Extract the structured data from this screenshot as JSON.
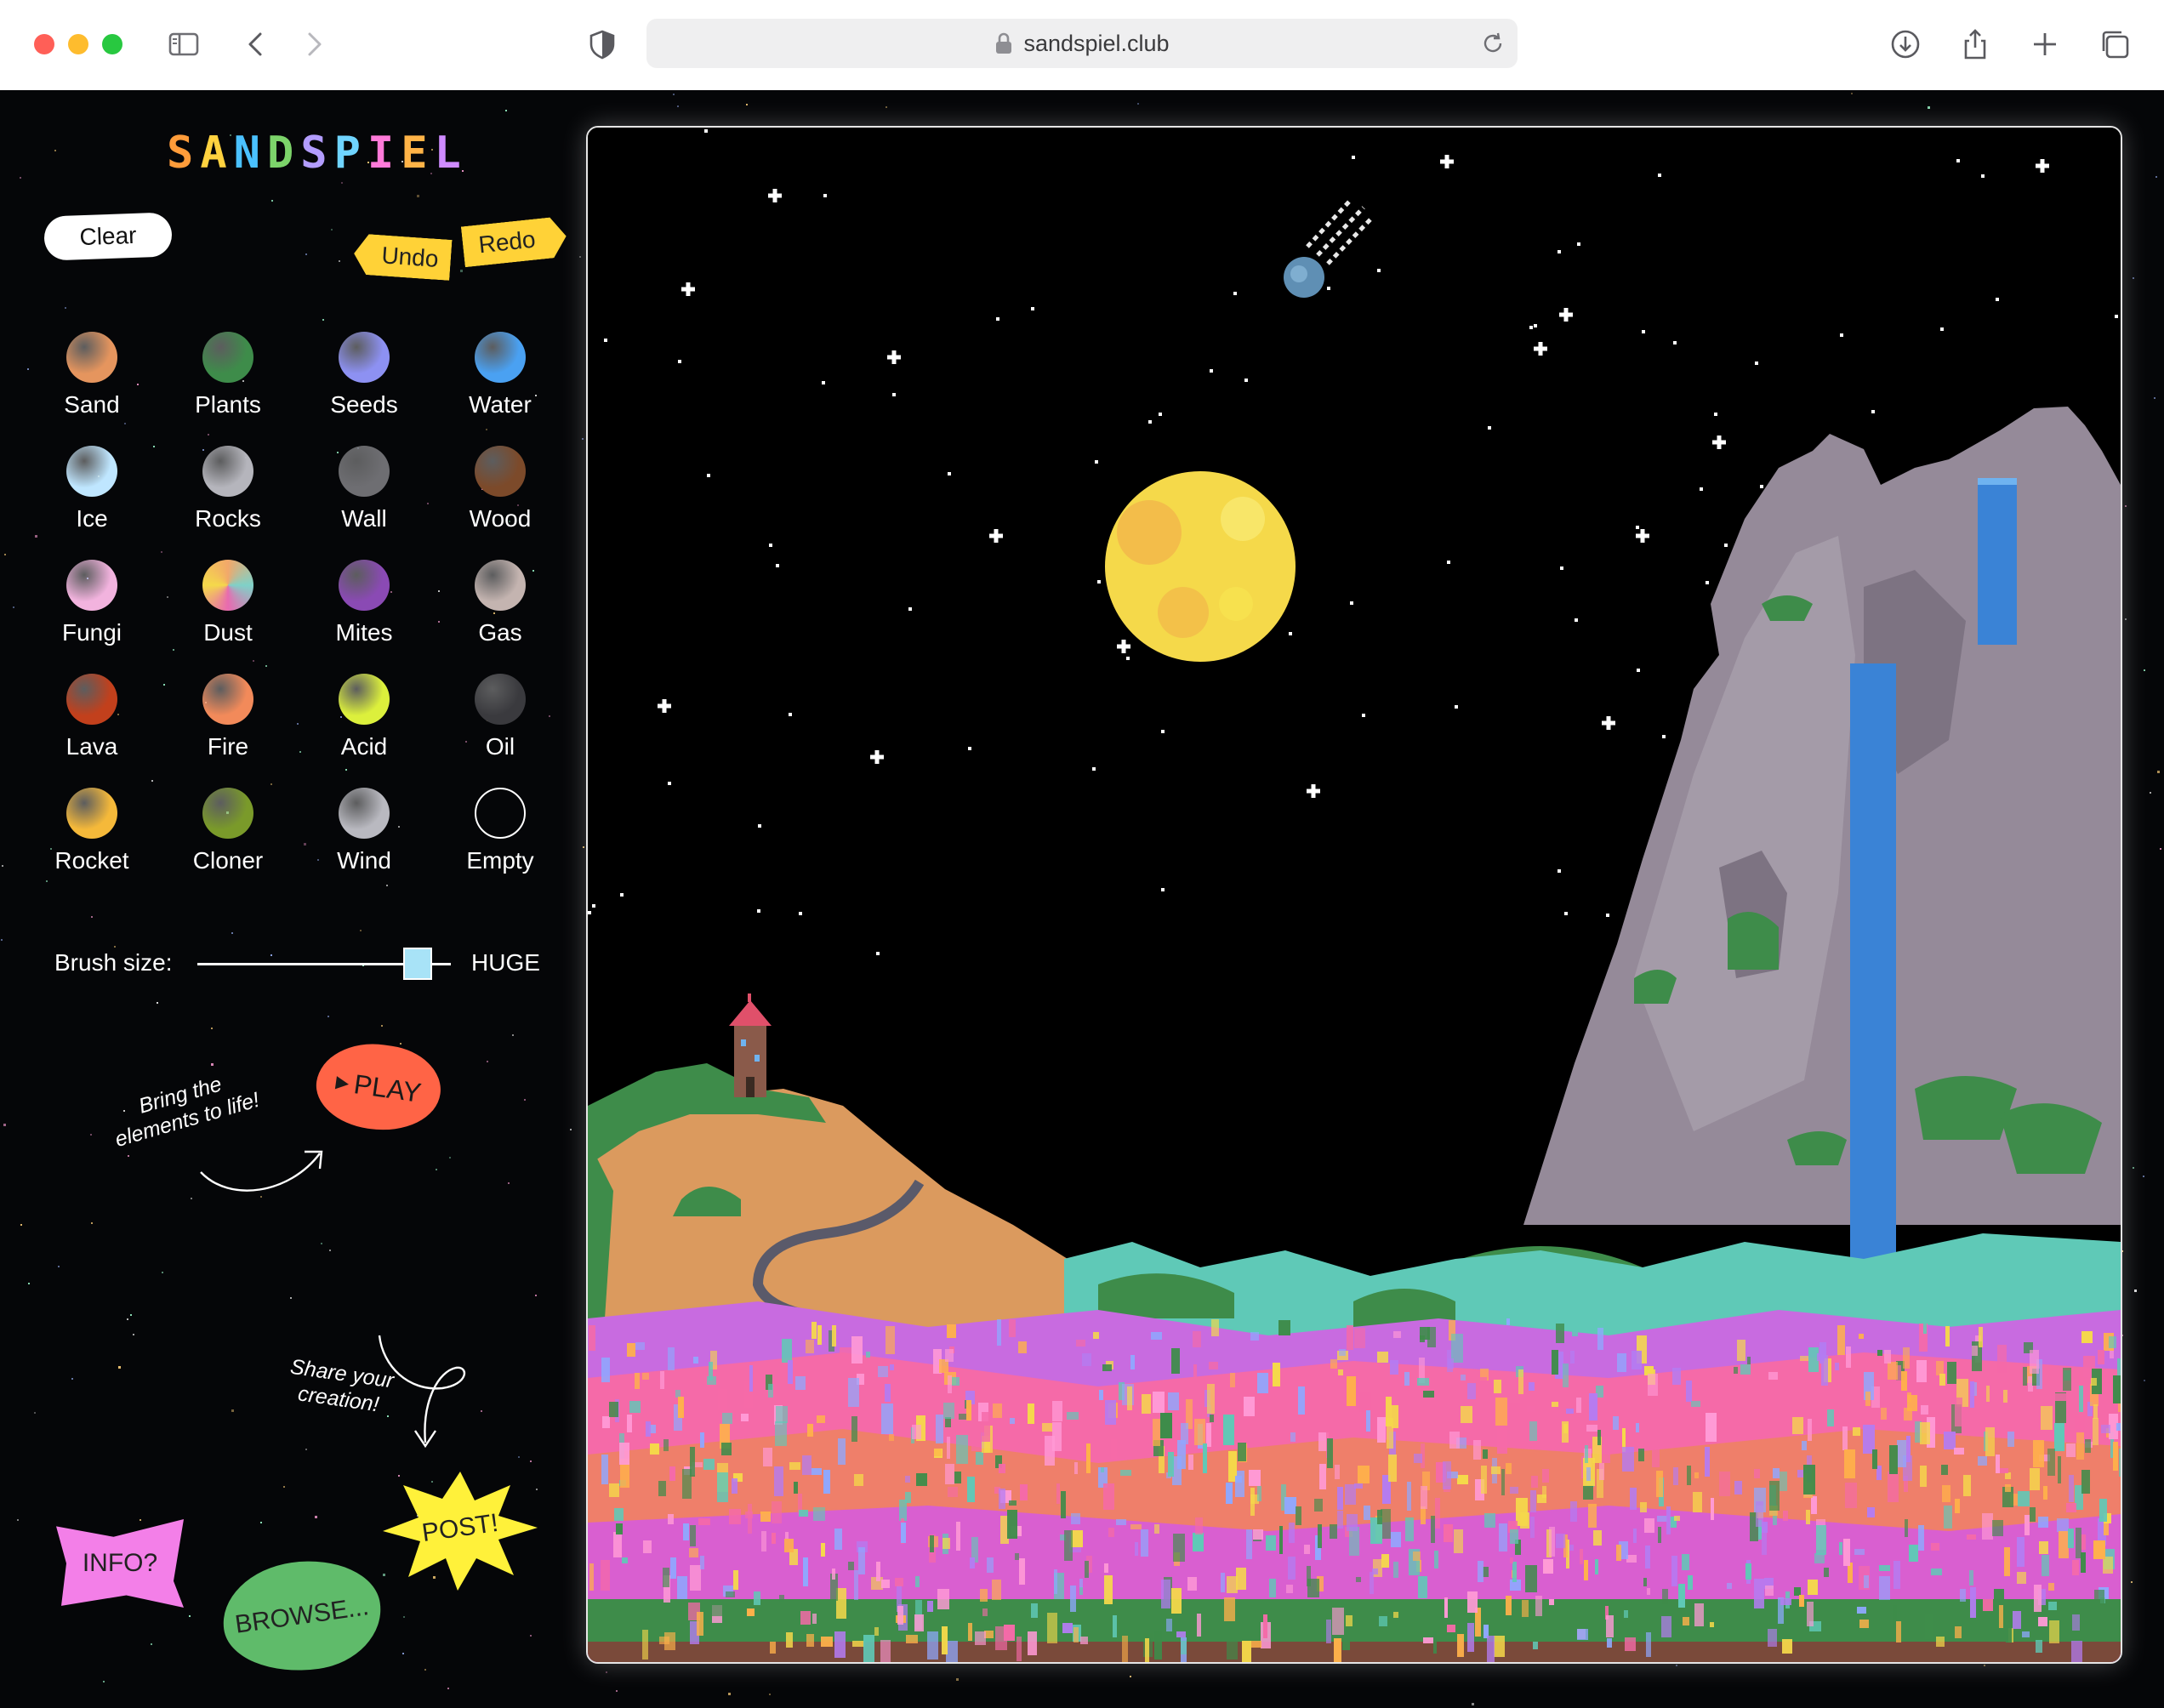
{
  "browser": {
    "url": "sandspiel.club",
    "traffic_lights": [
      "#ff5f57",
      "#febc2e",
      "#28c840"
    ],
    "icons": [
      "sidebar-icon",
      "back-icon",
      "forward-icon",
      "shield-icon",
      "lock-icon",
      "reload-icon",
      "download-icon",
      "share-icon",
      "new-tab-icon",
      "tabs-overview-icon"
    ]
  },
  "app": {
    "logo_letters": [
      "S",
      "A",
      "N",
      "D",
      "S",
      "P",
      "I",
      "E",
      "L"
    ],
    "logo_colors": [
      "#ff9c3a",
      "#ffd23f",
      "#4ac1ff",
      "#7cd36a",
      "#b39dff",
      "#6fd4ff",
      "#ff7ad9",
      "#ffb347",
      "#cf8bff"
    ]
  },
  "controls": {
    "clear": "Clear",
    "undo": "Undo",
    "redo": "Redo"
  },
  "elements": [
    {
      "name": "Sand",
      "color": "#e5955e"
    },
    {
      "name": "Plants",
      "color": "#3e8c4a"
    },
    {
      "name": "Seeds",
      "color": "#8d91f2"
    },
    {
      "name": "Water",
      "color": "#4aa1f2"
    },
    {
      "name": "Ice",
      "color": "#bfe6ff"
    },
    {
      "name": "Rocks",
      "color": "#b5b5bc"
    },
    {
      "name": "Wall",
      "color": "#6e6e72"
    },
    {
      "name": "Wood",
      "color": "#7c4a2a"
    },
    {
      "name": "Fungi",
      "color": "#f2b3de"
    },
    {
      "name": "Dust",
      "color": "#e8a070"
    },
    {
      "name": "Mites",
      "color": "#8a4ab4"
    },
    {
      "name": "Gas",
      "color": "#c4b4b0"
    },
    {
      "name": "Lava",
      "color": "#c2401c"
    },
    {
      "name": "Fire",
      "color": "#f28a5a"
    },
    {
      "name": "Acid",
      "color": "#dcf03c"
    },
    {
      "name": "Oil",
      "color": "#3a3a3e"
    },
    {
      "name": "Rocket",
      "color": "#f5b93a"
    },
    {
      "name": "Cloner",
      "color": "#7a9a2a"
    },
    {
      "name": "Wind",
      "color": "#b9b9c0"
    },
    {
      "name": "Empty",
      "color": "transparent"
    }
  ],
  "brush": {
    "label": "Brush size:",
    "value_label": "HUGE",
    "level": 0.87
  },
  "actions": {
    "play": "PLAY",
    "play_hint": "Bring the elements to life!",
    "share_hint": "Share your creation!",
    "post": "POST!",
    "info": "INFO?",
    "browse": "BROWSE..."
  },
  "colors": {
    "play": "#ff6446",
    "post": "#fff13a",
    "info": "#f37fe8",
    "browse": "#5fbb6a",
    "undo_redo": "#ffd237",
    "brush_thumb": "#a8e3f7"
  }
}
